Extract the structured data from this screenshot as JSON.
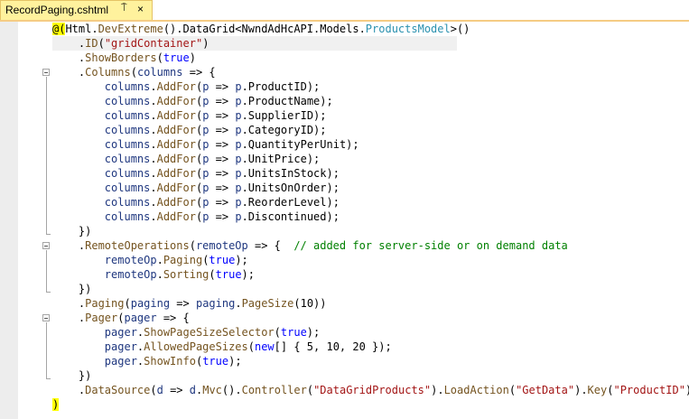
{
  "tab": {
    "title": "RecordPaging.cshtml",
    "pin_glyph": "⍑",
    "close_glyph": "×"
  },
  "code_lines": [
    "@(Html.DevExtreme().DataGrid<NwndAdHcAPI.Models.ProductsModel>()",
    "    .ID(\"gridContainer\")",
    "    .ShowBorders(true)",
    "    .Columns(columns => {",
    "        columns.AddFor(p => p.ProductID);",
    "        columns.AddFor(p => p.ProductName);",
    "        columns.AddFor(p => p.SupplierID);",
    "        columns.AddFor(p => p.CategoryID);",
    "        columns.AddFor(p => p.QuantityPerUnit);",
    "        columns.AddFor(p => p.UnitPrice);",
    "        columns.AddFor(p => p.UnitsInStock);",
    "        columns.AddFor(p => p.UnitsOnOrder);",
    "        columns.AddFor(p => p.ReorderLevel);",
    "        columns.AddFor(p => p.Discontinued);",
    "    })",
    "    .RemoteOperations(remoteOp => {  // added for server-side or on demand data",
    "        remoteOp.Paging(true);",
    "        remoteOp.Sorting(true);",
    "    })",
    "    .Paging(paging => paging.PageSize(10))",
    "    .Pager(pager => {",
    "        pager.ShowPageSizeSelector(true);",
    "        pager.AllowedPageSizes(new[] { 5, 10, 20 });",
    "        pager.ShowInfo(true);",
    "    })",
    "    .DataSource(d => d.Mvc().Controller(\"DataGridProducts\").LoadAction(\"GetData\").Key(\"ProductID\"))",
    ")"
  ],
  "colors": {
    "keyword": "#0000ff",
    "string": "#a31515",
    "type": "#2b91af",
    "comment": "#008000",
    "parameter": "#1f377f",
    "method": "#74531f",
    "razor_highlight": "#ffff00",
    "tab_background": "#fff29d"
  }
}
